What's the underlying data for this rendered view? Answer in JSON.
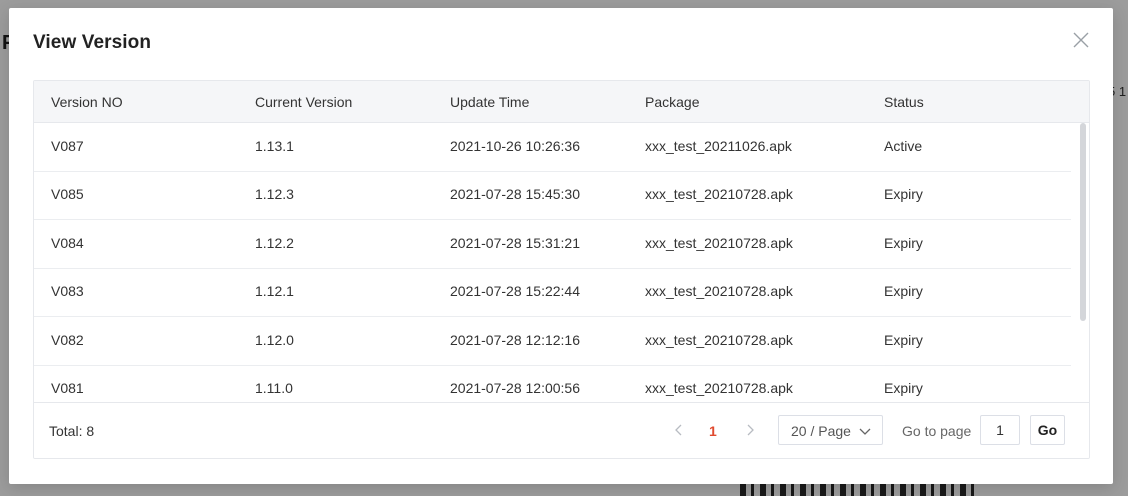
{
  "background": {
    "title_fragment": "P",
    "right_fragment": "5 1"
  },
  "modal": {
    "title": "View Version",
    "close_icon": "close-icon"
  },
  "table": {
    "columns": [
      "Version NO",
      "Current Version",
      "Update Time",
      "Package",
      "Status"
    ],
    "rows": [
      {
        "version_no": "V087",
        "current_version": "1.13.1",
        "update_time": "2021-10-26 10:26:36",
        "package": "xxx_test_20211026.apk",
        "status": "Active"
      },
      {
        "version_no": "V085",
        "current_version": "1.12.3",
        "update_time": "2021-07-28 15:45:30",
        "package": "xxx_test_20210728.apk",
        "status": "Expiry"
      },
      {
        "version_no": "V084",
        "current_version": "1.12.2",
        "update_time": "2021-07-28 15:31:21",
        "package": "xxx_test_20210728.apk",
        "status": "Expiry"
      },
      {
        "version_no": "V083",
        "current_version": "1.12.1",
        "update_time": "2021-07-28 15:22:44",
        "package": "xxx_test_20210728.apk",
        "status": "Expiry"
      },
      {
        "version_no": "V082",
        "current_version": "1.12.0",
        "update_time": "2021-07-28 12:12:16",
        "package": "xxx_test_20210728.apk",
        "status": "Expiry"
      },
      {
        "version_no": "V081",
        "current_version": "1.11.0",
        "update_time": "2021-07-28 12:00:56",
        "package": "xxx_test_20210728.apk",
        "status": "Expiry"
      }
    ]
  },
  "pagination": {
    "total_label": "Total:",
    "total_value": "8",
    "current_page": "1",
    "page_size": "20 / Page",
    "goto_label": "Go to page",
    "goto_value": "1",
    "go_button": "Go"
  },
  "colors": {
    "accent": "#e04a2f",
    "header_bg": "#f5f6f8",
    "border": "#e6e8ec"
  }
}
